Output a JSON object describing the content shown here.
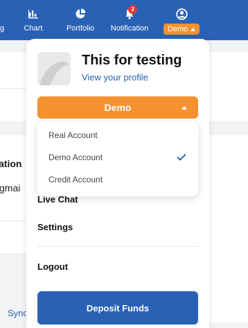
{
  "nav": {
    "items": [
      {
        "label": "g",
        "icon": "nav-icon"
      },
      {
        "label": "Chart",
        "icon": "bar-chart-icon"
      },
      {
        "label": "Portfolio",
        "icon": "pie-chart-icon"
      },
      {
        "label": "Notification",
        "icon": "bell-icon",
        "badge": "3"
      },
      {
        "label": "Demo",
        "icon": "user-icon"
      }
    ]
  },
  "background": {
    "label_ation": "ation",
    "label_gmai": "gmai",
    "label_sync": "Sync"
  },
  "profile": {
    "name": "This for testing",
    "link": "View your profile"
  },
  "account": {
    "selected": "Demo",
    "options": [
      {
        "label": "Real Account",
        "checked": false
      },
      {
        "label": "Demo Account",
        "checked": true
      },
      {
        "label": "Credit Account",
        "checked": false
      }
    ]
  },
  "menu": {
    "live_chat": "Live Chat",
    "settings": "Settings",
    "logout": "Logout",
    "deposit": "Deposit Funds"
  },
  "colors": {
    "primary": "#2962b5",
    "accent": "#f5922f"
  }
}
